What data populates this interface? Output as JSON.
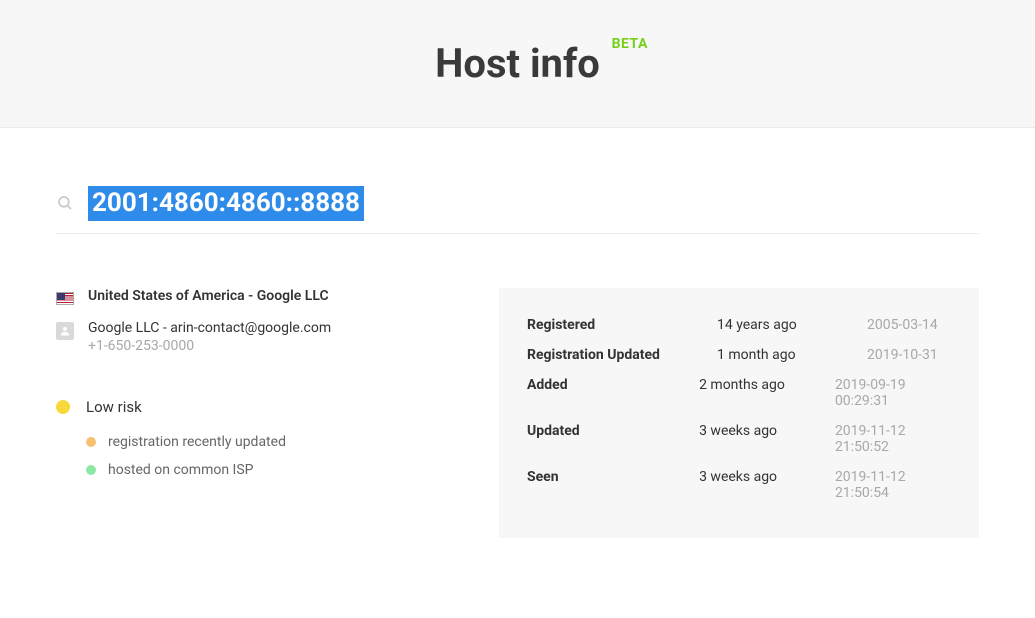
{
  "header": {
    "title": "Host info",
    "badge": "BETA"
  },
  "search": {
    "value": "2001:4860:4860::8888"
  },
  "host": {
    "location_org": "United States of America - Google LLC",
    "contact_line1": "Google LLC - arin-contact@google.com",
    "contact_line2": "+1-650-253-0000"
  },
  "meta": [
    {
      "label": "Registered",
      "relative": "14 years ago",
      "date": "2005-03-14"
    },
    {
      "label": "Registration Updated",
      "relative": "1 month ago",
      "date": "2019-10-31"
    },
    {
      "label": "Added",
      "relative": "2 months ago",
      "date": "2019-09-19 00:29:31"
    },
    {
      "label": "Updated",
      "relative": "3 weeks ago",
      "date": "2019-11-12 21:50:52"
    },
    {
      "label": "Seen",
      "relative": "3 weeks ago",
      "date": "2019-11-12 21:50:54"
    }
  ],
  "risk": {
    "level": "Low risk",
    "level_color": "yellow",
    "items": [
      {
        "text": "registration recently updated",
        "color": "orange"
      },
      {
        "text": "hosted on common ISP",
        "color": "green"
      }
    ]
  }
}
